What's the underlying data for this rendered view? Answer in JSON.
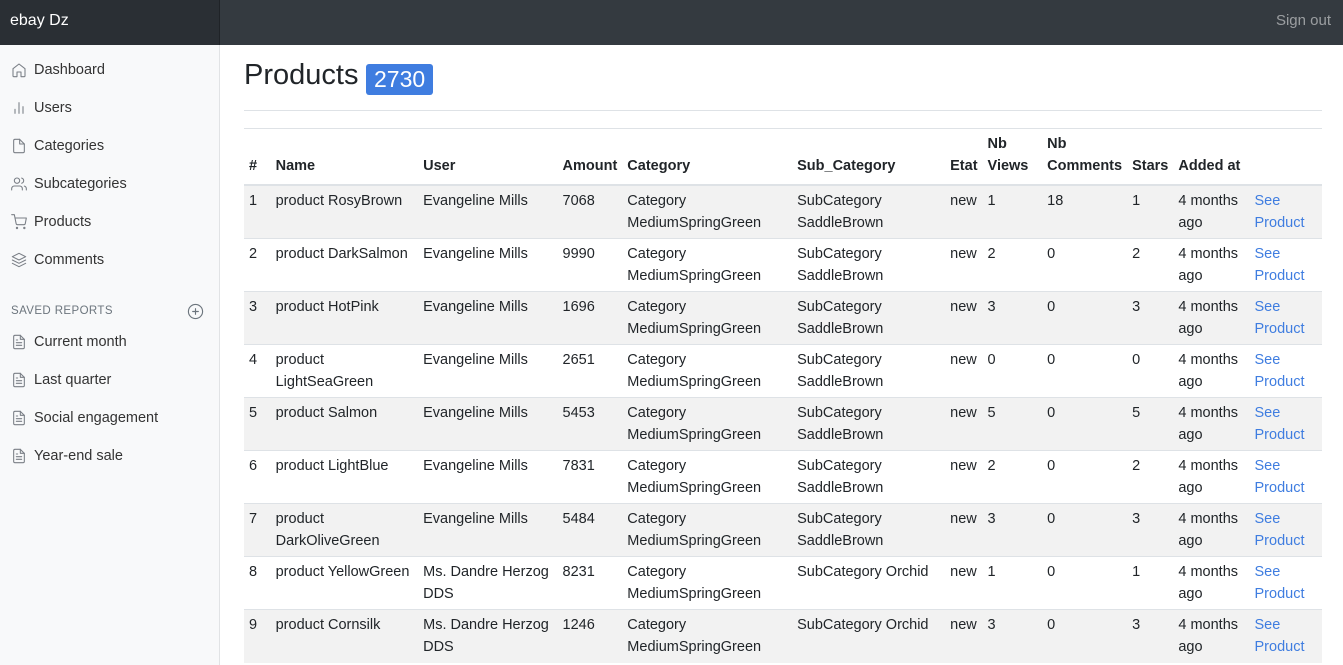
{
  "brand": "ebay Dz",
  "signout": "Sign out",
  "sidebar": {
    "items": [
      {
        "label": "Dashboard",
        "icon": "home-icon"
      },
      {
        "label": "Users",
        "icon": "bar-chart-icon"
      },
      {
        "label": "Categories",
        "icon": "file-icon"
      },
      {
        "label": "Subcategories",
        "icon": "users-icon"
      },
      {
        "label": "Products",
        "icon": "cart-icon"
      },
      {
        "label": "Comments",
        "icon": "layers-icon"
      }
    ],
    "saved_heading": "SAVED REPORTS",
    "reports": [
      {
        "label": "Current month",
        "icon": "file-text-icon"
      },
      {
        "label": "Last quarter",
        "icon": "file-text-icon"
      },
      {
        "label": "Social engagement",
        "icon": "file-text-icon"
      },
      {
        "label": "Year-end sale",
        "icon": "file-text-icon"
      }
    ]
  },
  "main": {
    "title": "Products",
    "count": "2730",
    "columns": {
      "num": "#",
      "name": "Name",
      "user": "User",
      "amount": "Amount",
      "category": "Category",
      "sub_category": "Sub_Category",
      "etat": "Etat",
      "nb_views_1": "Nb",
      "nb_views_2": "Views",
      "nb_comments_1": "Nb",
      "nb_comments_2": "Comments",
      "stars": "Stars",
      "added_at": "Added at"
    },
    "rows": [
      {
        "num": "1",
        "name": "product RosyBrown",
        "user": "Evangeline Mills",
        "amount": "7068",
        "category": "Category MediumSpringGreen",
        "sub_category": "SubCategory SaddleBrown",
        "etat": "new",
        "views": "1",
        "comments": "18",
        "stars": "1",
        "added": "4 months ago",
        "link": "See Product"
      },
      {
        "num": "2",
        "name": "product DarkSalmon",
        "user": "Evangeline Mills",
        "amount": "9990",
        "category": "Category MediumSpringGreen",
        "sub_category": "SubCategory SaddleBrown",
        "etat": "new",
        "views": "2",
        "comments": "0",
        "stars": "2",
        "added": "4 months ago",
        "link": "See Product"
      },
      {
        "num": "3",
        "name": "product HotPink",
        "user": "Evangeline Mills",
        "amount": "1696",
        "category": "Category MediumSpringGreen",
        "sub_category": "SubCategory SaddleBrown",
        "etat": "new",
        "views": "3",
        "comments": "0",
        "stars": "3",
        "added": "4 months ago",
        "link": "See Product"
      },
      {
        "num": "4",
        "name": "product LightSeaGreen",
        "user": "Evangeline Mills",
        "amount": "2651",
        "category": "Category MediumSpringGreen",
        "sub_category": "SubCategory SaddleBrown",
        "etat": "new",
        "views": "0",
        "comments": "0",
        "stars": "0",
        "added": "4 months ago",
        "link": "See Product"
      },
      {
        "num": "5",
        "name": "product Salmon",
        "user": "Evangeline Mills",
        "amount": "5453",
        "category": "Category MediumSpringGreen",
        "sub_category": "SubCategory SaddleBrown",
        "etat": "new",
        "views": "5",
        "comments": "0",
        "stars": "5",
        "added": "4 months ago",
        "link": "See Product"
      },
      {
        "num": "6",
        "name": "product LightBlue",
        "user": "Evangeline Mills",
        "amount": "7831",
        "category": "Category MediumSpringGreen",
        "sub_category": "SubCategory SaddleBrown",
        "etat": "new",
        "views": "2",
        "comments": "0",
        "stars": "2",
        "added": "4 months ago",
        "link": "See Product"
      },
      {
        "num": "7",
        "name": "product DarkOliveGreen",
        "user": "Evangeline Mills",
        "amount": "5484",
        "category": "Category MediumSpringGreen",
        "sub_category": "SubCategory SaddleBrown",
        "etat": "new",
        "views": "3",
        "comments": "0",
        "stars": "3",
        "added": "4 months ago",
        "link": "See Product"
      },
      {
        "num": "8",
        "name": "product YellowGreen",
        "user": "Ms. Dandre Herzog DDS",
        "amount": "8231",
        "category": "Category MediumSpringGreen",
        "sub_category": "SubCategory Orchid",
        "etat": "new",
        "views": "1",
        "comments": "0",
        "stars": "1",
        "added": "4 months ago",
        "link": "See Product"
      },
      {
        "num": "9",
        "name": "product Cornsilk",
        "user": "Ms. Dandre Herzog DDS",
        "amount": "1246",
        "category": "Category MediumSpringGreen",
        "sub_category": "SubCategory Orchid",
        "etat": "new",
        "views": "3",
        "comments": "0",
        "stars": "3",
        "added": "4 months ago",
        "link": "See Product"
      }
    ]
  },
  "colors": {
    "topbar": "#343a40",
    "brand_bg": "#2a2f34",
    "accent": "#3f7de0",
    "stripe": "#f2f2f2"
  }
}
